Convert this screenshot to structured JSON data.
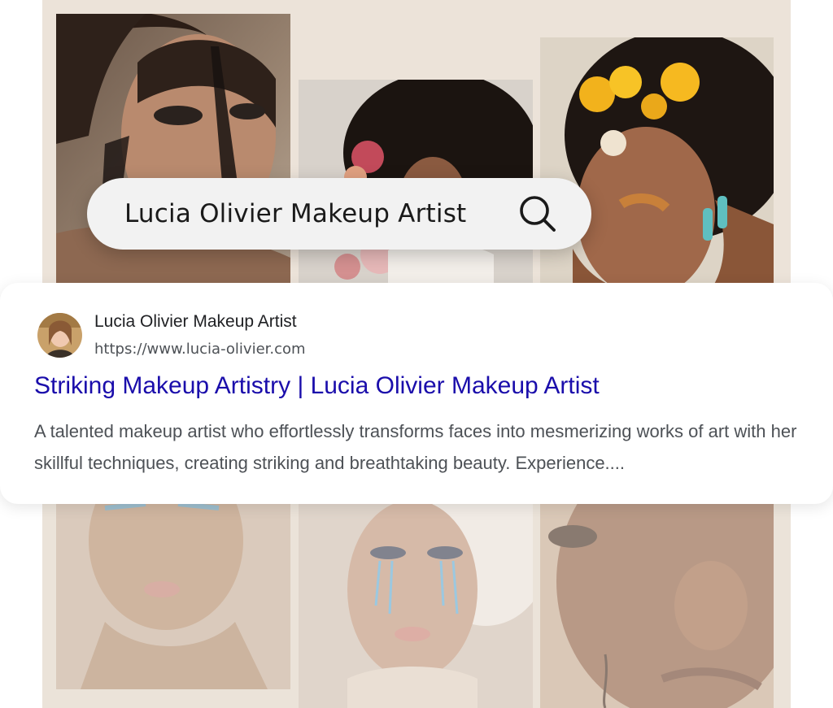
{
  "search": {
    "query": "Lucia Olivier Makeup Artist",
    "icon": "search-icon"
  },
  "result": {
    "site_name": "Lucia Olivier Makeup Artist",
    "url": "https://www.lucia-olivier.com",
    "title": "Striking Makeup Artistry | Lucia Olivier Makeup Artist",
    "snippet": "A talented makeup artist who effortlessly transforms faces into mesmerizing works of art with her skillful techniques, creating striking and breathtaking beauty. Experience...."
  },
  "gallery": {
    "photos": [
      "dramatic-makeup-portrait",
      "afro-hair-flowers-portrait",
      "yellow-flowers-golden-eyeshadow-portrait",
      "blue-eyeliner-portrait",
      "feather-blue-tears-portrait",
      "close-up-face-portrait"
    ]
  },
  "colors": {
    "backdrop": "#ece3d9",
    "link": "#1a0dab",
    "snippet": "#4d5156"
  }
}
